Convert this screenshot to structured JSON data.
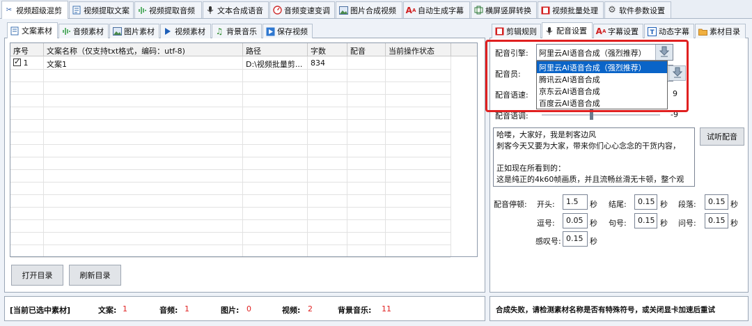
{
  "top_tabs": [
    {
      "label": "视频超级混剪",
      "icon": "scissors-icon"
    },
    {
      "label": "视频提取文案",
      "icon": "document-icon"
    },
    {
      "label": "视频提取音频",
      "icon": "audio-wave-icon"
    },
    {
      "label": "文本合成语音",
      "icon": "microphone-icon"
    },
    {
      "label": "音频变速变调",
      "icon": "speed-gauge-icon"
    },
    {
      "label": "图片合成视频",
      "icon": "image-icon"
    },
    {
      "label": "自动生成字幕",
      "icon": "subtitle-icon"
    },
    {
      "label": "横屏竖屏转换",
      "icon": "rotate-screen-icon"
    },
    {
      "label": "视频批量处理",
      "icon": "film-icon"
    },
    {
      "label": "软件参数设置",
      "icon": "gear-icon"
    }
  ],
  "left_tabs": [
    {
      "label": "文案素材",
      "icon": "document-icon"
    },
    {
      "label": "音频素材",
      "icon": "audio-wave-icon"
    },
    {
      "label": "图片素材",
      "icon": "image-icon"
    },
    {
      "label": "视频素材",
      "icon": "play-icon"
    },
    {
      "label": "背景音乐",
      "icon": "music-note-icon"
    },
    {
      "label": "保存视频",
      "icon": "play-box-icon"
    }
  ],
  "table": {
    "headers": [
      "序号",
      "文案名称（仅支持txt格式，编码：utf-8)",
      "路径",
      "字数",
      "配音",
      "当前操作状态"
    ],
    "rows": [
      {
        "index": "1",
        "name": "文案1",
        "path": "D:\\视频批量剪...",
        "count": "834",
        "voice": "",
        "status": "",
        "checked": true
      }
    ]
  },
  "buttons": {
    "open_dir": "打开目录",
    "refresh_dir": "刷新目录",
    "preview_voice": "试听配音"
  },
  "right_tabs": [
    {
      "label": "剪辑规则",
      "icon": "film-icon"
    },
    {
      "label": "配音设置",
      "icon": "microphone-icon"
    },
    {
      "label": "字幕设置",
      "icon": "subtitle-icon"
    },
    {
      "label": "动态字幕",
      "icon": "text-box-icon"
    },
    {
      "label": "素材目录",
      "icon": "folder-icon"
    }
  ],
  "voice": {
    "engine_label": "配音引擎:",
    "engine_value": "阿里云AI语音合成（强烈推荐）",
    "engine_options": [
      "阿里云AI语音合成（强烈推荐）",
      "腾讯云AI语音合成",
      "京东云AI语音合成",
      "百度云AI语音合成"
    ],
    "speaker_label": "配音员:",
    "speed_label": "配音语速:",
    "speed_value": "9",
    "pitch_label": "配音语调:",
    "pitch_value": "-9",
    "sample_text": [
      "哈喽，大家好，我是刺客边风",
      "刺客今天又要为大家，带来你们心心念念的干货内容，",
      "",
      "正如现在所看到的：",
      "这是纯正的4k60帧画质，并且流畅丝滑无卡顿，整个观"
    ],
    "pause_title": "配音停顿:",
    "pauses": [
      {
        "label": "开头:",
        "value": "1.5",
        "unit": "秒"
      },
      {
        "label": "结尾:",
        "value": "0.15",
        "unit": "秒"
      },
      {
        "label": "段落:",
        "value": "0.15",
        "unit": "秒"
      },
      {
        "label": "逗号:",
        "value": "0.05",
        "unit": "秒"
      },
      {
        "label": "句号:",
        "value": "0.15",
        "unit": "秒"
      },
      {
        "label": "问号:",
        "value": "0.15",
        "unit": "秒"
      },
      {
        "label": "感叹号:",
        "value": "0.15",
        "unit": "秒"
      }
    ]
  },
  "status": {
    "selected_label": "[当前已选中素材]",
    "items": [
      {
        "label": "文案:",
        "value": "1"
      },
      {
        "label": "音频:",
        "value": "1"
      },
      {
        "label": "图片:",
        "value": "0"
      },
      {
        "label": "视频:",
        "value": "2"
      },
      {
        "label": "背景音乐:",
        "value": "11"
      }
    ],
    "message": "合成失败，请检测素材名称是否有特殊符号，或关闭显卡加速后重试"
  },
  "colors": {
    "highlight_border": "#e02020",
    "selection": "#0a64c8",
    "status_value": "#e02020"
  }
}
